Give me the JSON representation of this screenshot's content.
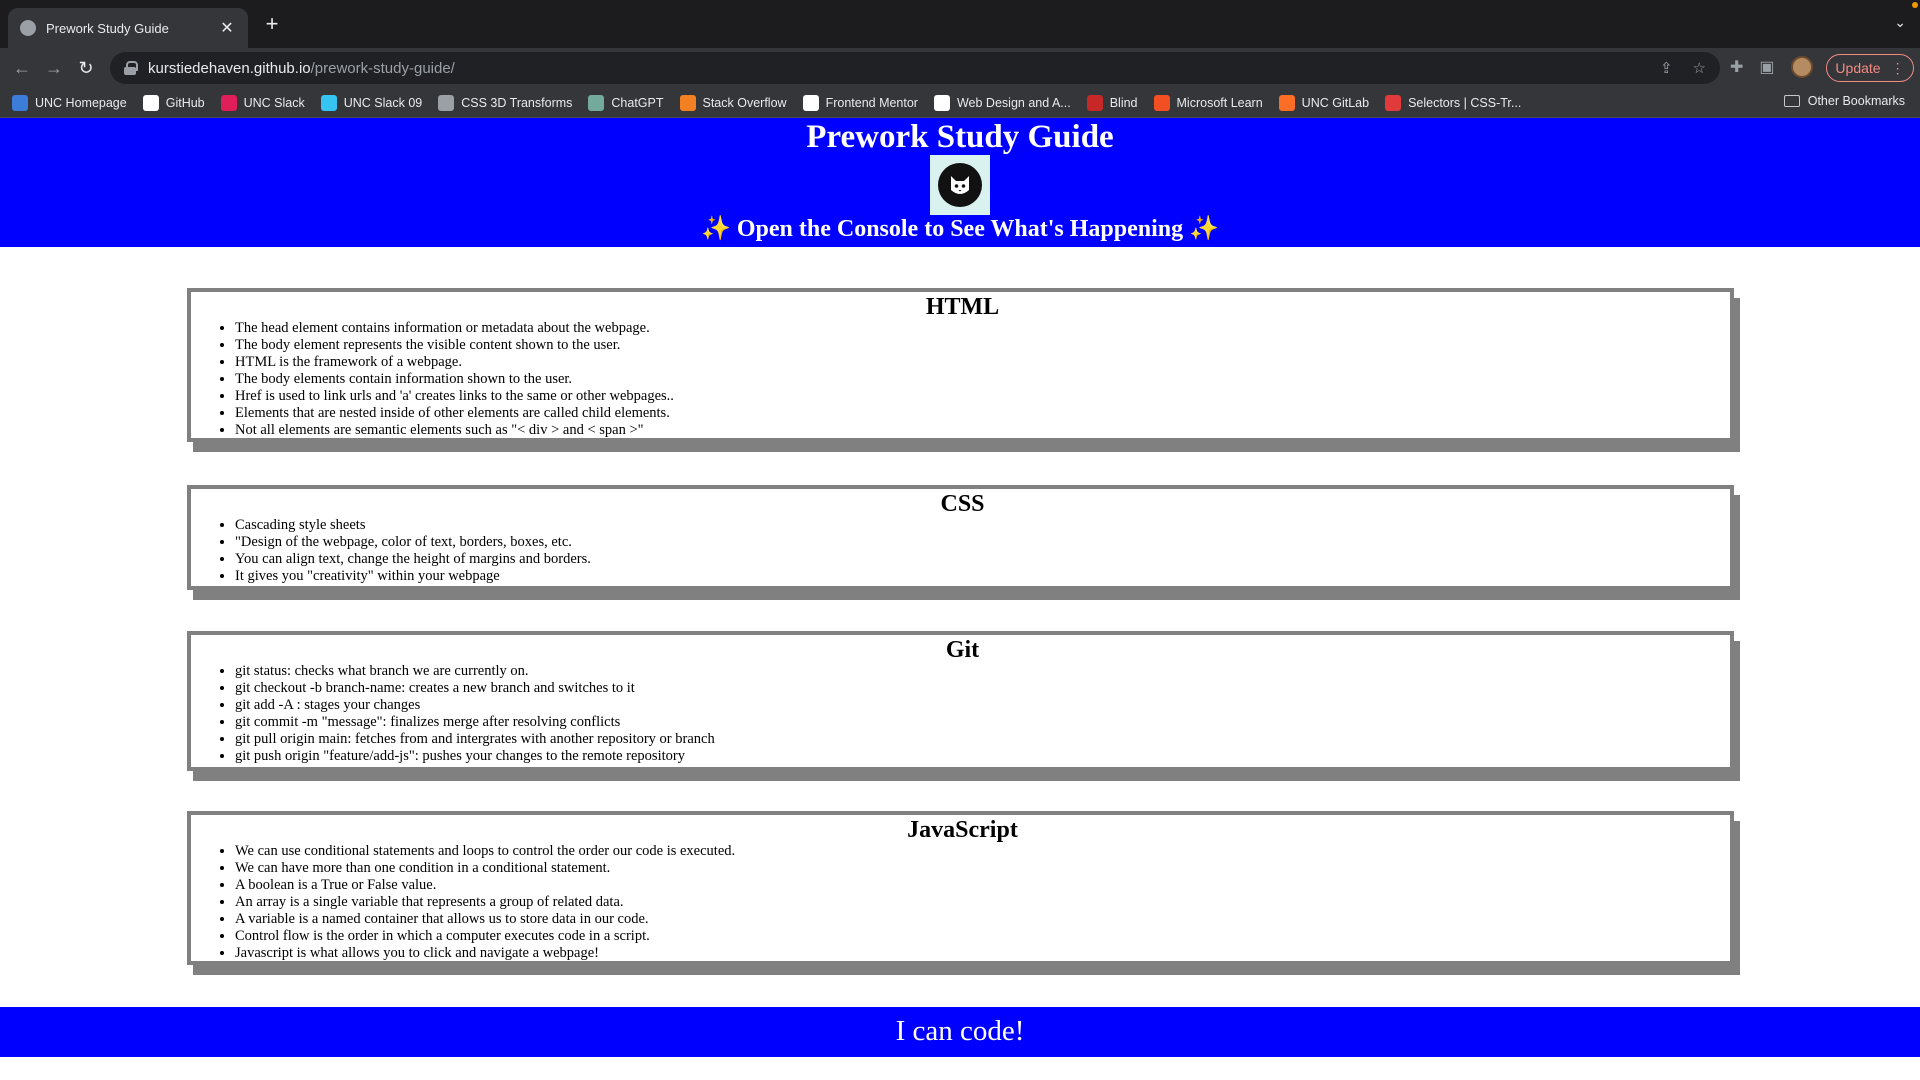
{
  "browser": {
    "tab_title": "Prework Study Guide",
    "url_host": "kurstiedehaven.github.io",
    "url_path": "/prework-study-guide/",
    "update_label": "Update",
    "bookmarks": [
      {
        "label": "UNC Homepage",
        "icon": "unc-homepage-icon",
        "color": "#3b7dd8"
      },
      {
        "label": "GitHub",
        "icon": "github-icon",
        "color": "#ffffff"
      },
      {
        "label": "UNC Slack",
        "icon": "slack-icon",
        "color": "#e01e5a"
      },
      {
        "label": "UNC Slack 09",
        "icon": "slack-icon",
        "color": "#36c5f0"
      },
      {
        "label": "CSS 3D Transforms",
        "icon": "globe-icon",
        "color": "#9aa0a6"
      },
      {
        "label": "ChatGPT",
        "icon": "chatgpt-icon",
        "color": "#74aa9c"
      },
      {
        "label": "Stack Overflow",
        "icon": "stack-overflow-icon",
        "color": "#f48024"
      },
      {
        "label": "Frontend Mentor",
        "icon": "frontend-mentor-icon",
        "color": "#ffffff"
      },
      {
        "label": "Web Design and A...",
        "icon": "w3-icon",
        "color": "#ffffff"
      },
      {
        "label": "Blind",
        "icon": "blind-icon",
        "color": "#c62828"
      },
      {
        "label": "Microsoft Learn",
        "icon": "microsoft-icon",
        "color": "#f25022"
      },
      {
        "label": "UNC GitLab",
        "icon": "gitlab-icon",
        "color": "#fc6d26"
      },
      {
        "label": "Selectors | CSS-Tr...",
        "icon": "css-tricks-icon",
        "color": "#e03a3a"
      }
    ],
    "other_bookmarks": "Other Bookmarks"
  },
  "header": {
    "title": "Prework Study Guide",
    "subtitle": "✨ Open the Console to See What's Happening ✨",
    "bg_color": "#0000ff"
  },
  "sections": [
    {
      "title": "HTML",
      "items": [
        "The head element contains information or metadata about the webpage.",
        "The body element represents the visible content shown to the user.",
        "HTML is the framework of a webpage.",
        "The body elements contain information shown to the user.",
        "Href is used to link urls and 'a' creates links to the same or other webpages..",
        "Elements that are nested inside of other elements are called child elements.",
        "Not all elements are semantic elements such as \"< div > and < span >\""
      ]
    },
    {
      "title": "CSS",
      "items": [
        "Cascading style sheets",
        "\"Design of the webpage, color of text, borders, boxes, etc.",
        "You can align text, change the height of margins and borders.",
        "It gives you \"creativity\" within your webpage"
      ]
    },
    {
      "title": "Git",
      "items": [
        "git status: checks what branch we are currently on.",
        "git checkout -b branch-name: creates a new branch and switches to it",
        "git add -A : stages your changes",
        "git commit -m \"message\": finalizes merge after resolving conflicts",
        "git pull origin main: fetches from and intergrates with another repository or branch",
        "git push origin \"feature/add-js\": pushes your changes to the remote repository"
      ]
    },
    {
      "title": "JavaScript",
      "items": [
        "We can use conditional statements and loops to control the order our code is executed.",
        "We can have more than one condition in a conditional statement.",
        "A boolean is a True or False value.",
        "An array is a single variable that represents a group of related data.",
        "A variable is a named container that allows us to store data in our code.",
        "Control flow is the order in which a computer executes code in a script.",
        "Javascript is what allows you to click and navigate a webpage!"
      ]
    }
  ],
  "footer": {
    "text": "I can code!"
  }
}
